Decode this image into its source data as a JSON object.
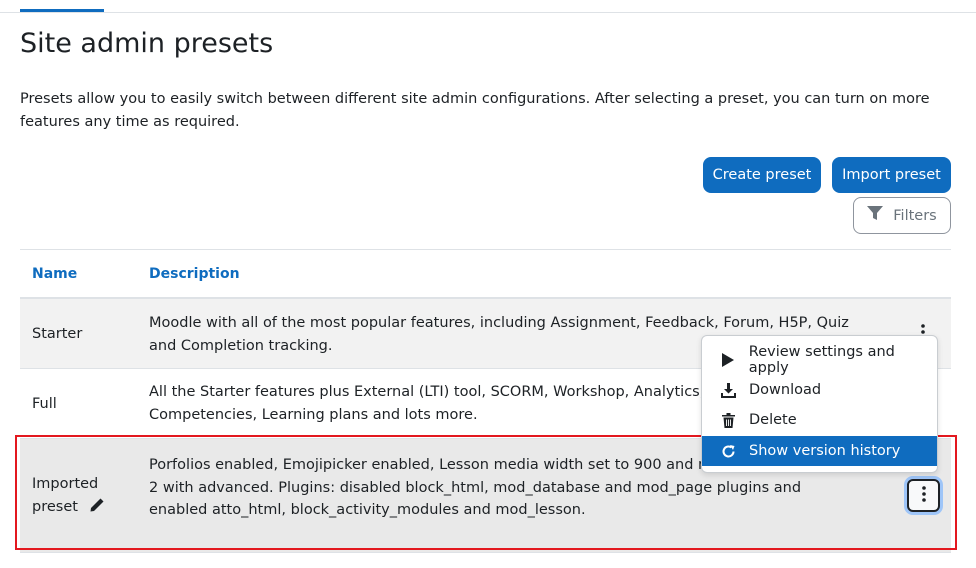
{
  "page": {
    "title": "Site admin presets",
    "intro": "Presets allow you to easily switch between different site admin configurations. After selecting a preset, you can turn on more features any time as required."
  },
  "actions": {
    "create_label": "Create preset",
    "import_label": "Import preset",
    "filters_label": "Filters"
  },
  "table": {
    "headers": {
      "name": "Name",
      "description": "Description"
    },
    "rows": [
      {
        "name": "Starter",
        "description": "Moodle with all of the most popular features, including Assignment, Feedback, Forum, H5P, Quiz and Completion tracking."
      },
      {
        "name": "Full",
        "description": "All the Starter features plus External (LTI) tool, SCORM, Workshop, Analytics, Badges, Competencies, Learning plans and lots more."
      },
      {
        "name": "Imported preset",
        "description": "Porfolios enabled, Emojipicker enabled, Lesson media width set to 900 and maxanswers set to 2 with advanced. Plugins: disabled block_html, mod_database and mod_page plugins and enabled atto_html, block_activity_modules and mod_lesson."
      }
    ]
  },
  "menu": {
    "items": [
      {
        "label": "Review settings and apply",
        "icon": "play-icon"
      },
      {
        "label": "Download",
        "icon": "download-icon"
      },
      {
        "label": "Delete",
        "icon": "trash-icon"
      },
      {
        "label": "Show version history",
        "icon": "history-icon"
      }
    ]
  },
  "colors": {
    "primary": "#0f6cbf",
    "highlight": "#e3181f"
  }
}
